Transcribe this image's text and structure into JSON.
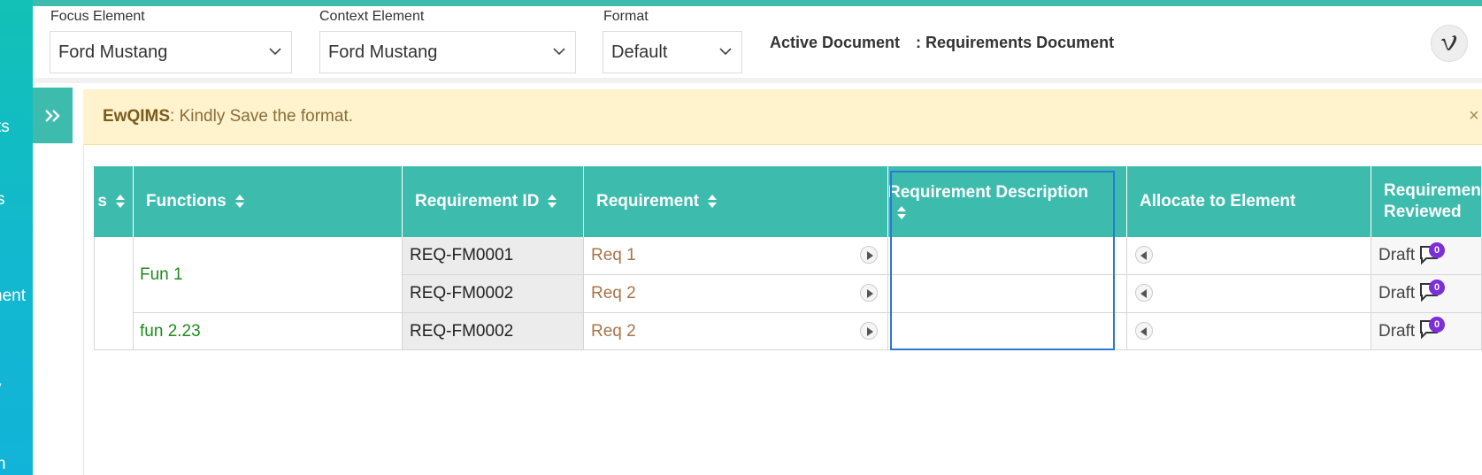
{
  "sidebar": {
    "fragments": [
      "ts",
      "s",
      "nent",
      "y",
      "n"
    ]
  },
  "header": {
    "focus_label": "Focus Element",
    "focus_value": "Ford Mustang",
    "context_label": "Context Element",
    "context_value": "Ford Mustang",
    "format_label": "Format",
    "format_value": "Default",
    "active_doc_label": "Active Document",
    "active_doc_value": ": Requirements Document"
  },
  "alert": {
    "brand": "EwQIMS",
    "message": " : Kindly Save the format.",
    "close": "×"
  },
  "table": {
    "columns": [
      "s",
      "Functions",
      "Requirement ID",
      "Requirement",
      "Requirement Description",
      "Allocate to Element",
      "Requiremen Reviewed"
    ],
    "rows": [
      {
        "function": "Fun 1",
        "req_id": "REQ-FM0001",
        "requirement": "Req 1",
        "description": "",
        "status": "Draft",
        "comments": "0"
      },
      {
        "function": "",
        "req_id": "REQ-FM0002",
        "requirement": "Req 2",
        "description": "",
        "status": "Draft",
        "comments": "0"
      },
      {
        "function": "fun 2.23",
        "req_id": "REQ-FM0002",
        "requirement": "Req 2",
        "description": "",
        "status": "Draft",
        "comments": "0"
      }
    ]
  },
  "colors": {
    "teal": "#3dbcae",
    "alert_bg": "#fff3cd",
    "badge": "#7b2fd9",
    "focus_outline": "#2b78d6"
  }
}
